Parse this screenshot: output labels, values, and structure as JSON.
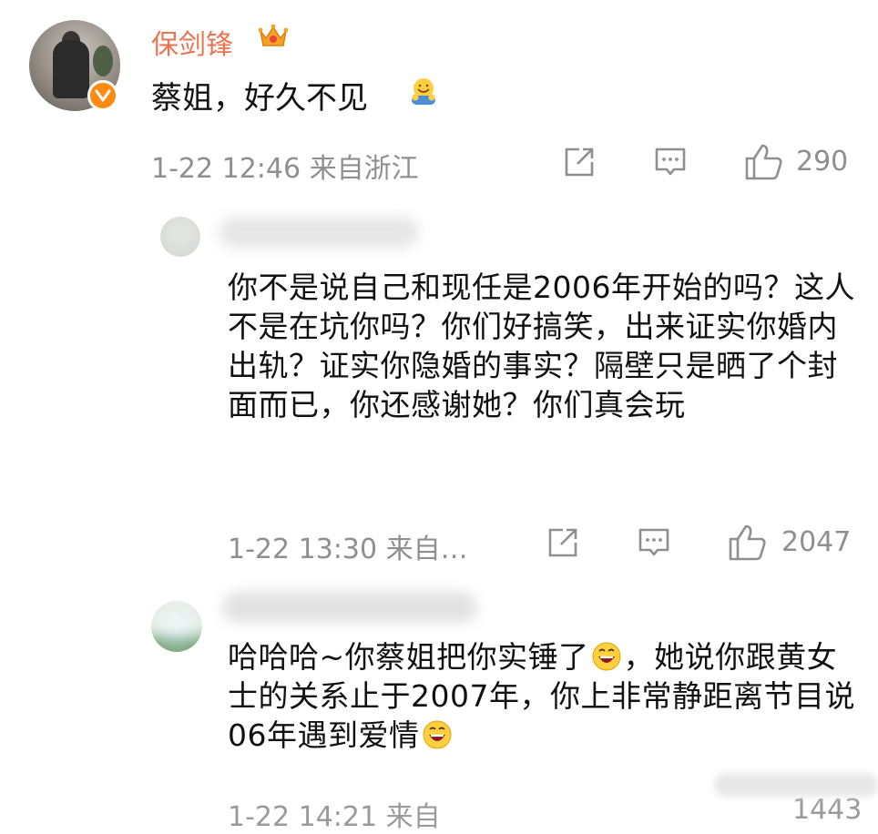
{
  "comment": {
    "username": "保剑锋",
    "text": "蔡姐，好久不见",
    "meta": "1-22 12:46 来自浙江",
    "likes": "290"
  },
  "replies": [
    {
      "text": "你不是说自己和现任是2006年开始的吗？这人不是在坑你吗？你们好搞笑，出来证实你婚内出轨？证实你隐婚的事实？隔壁只是晒了个封面而已，你还感谢她？你们真会玩",
      "meta": "1-22 13:30 来自…",
      "likes": "2047"
    },
    {
      "text_part1": "哈哈哈~你蔡姐把你实锤了",
      "text_part2": "，她说你跟黄女士的关系止于2007年，你上非常静距离节目说06年遇到爱情",
      "meta_partial": "1-22 14:21 来自",
      "likes_partial": "1443"
    }
  ],
  "icons": {
    "verify": "verified-badge-icon",
    "crown": "crown-icon",
    "hug": "hug-emoji-icon",
    "share": "share-icon",
    "comment": "comment-icon",
    "like": "thumbs-up-icon",
    "laugh": "laughing-emoji-icon"
  },
  "colors": {
    "username": "#eb7350",
    "meta": "#8f8f8f",
    "verify": "#ff8a12"
  }
}
